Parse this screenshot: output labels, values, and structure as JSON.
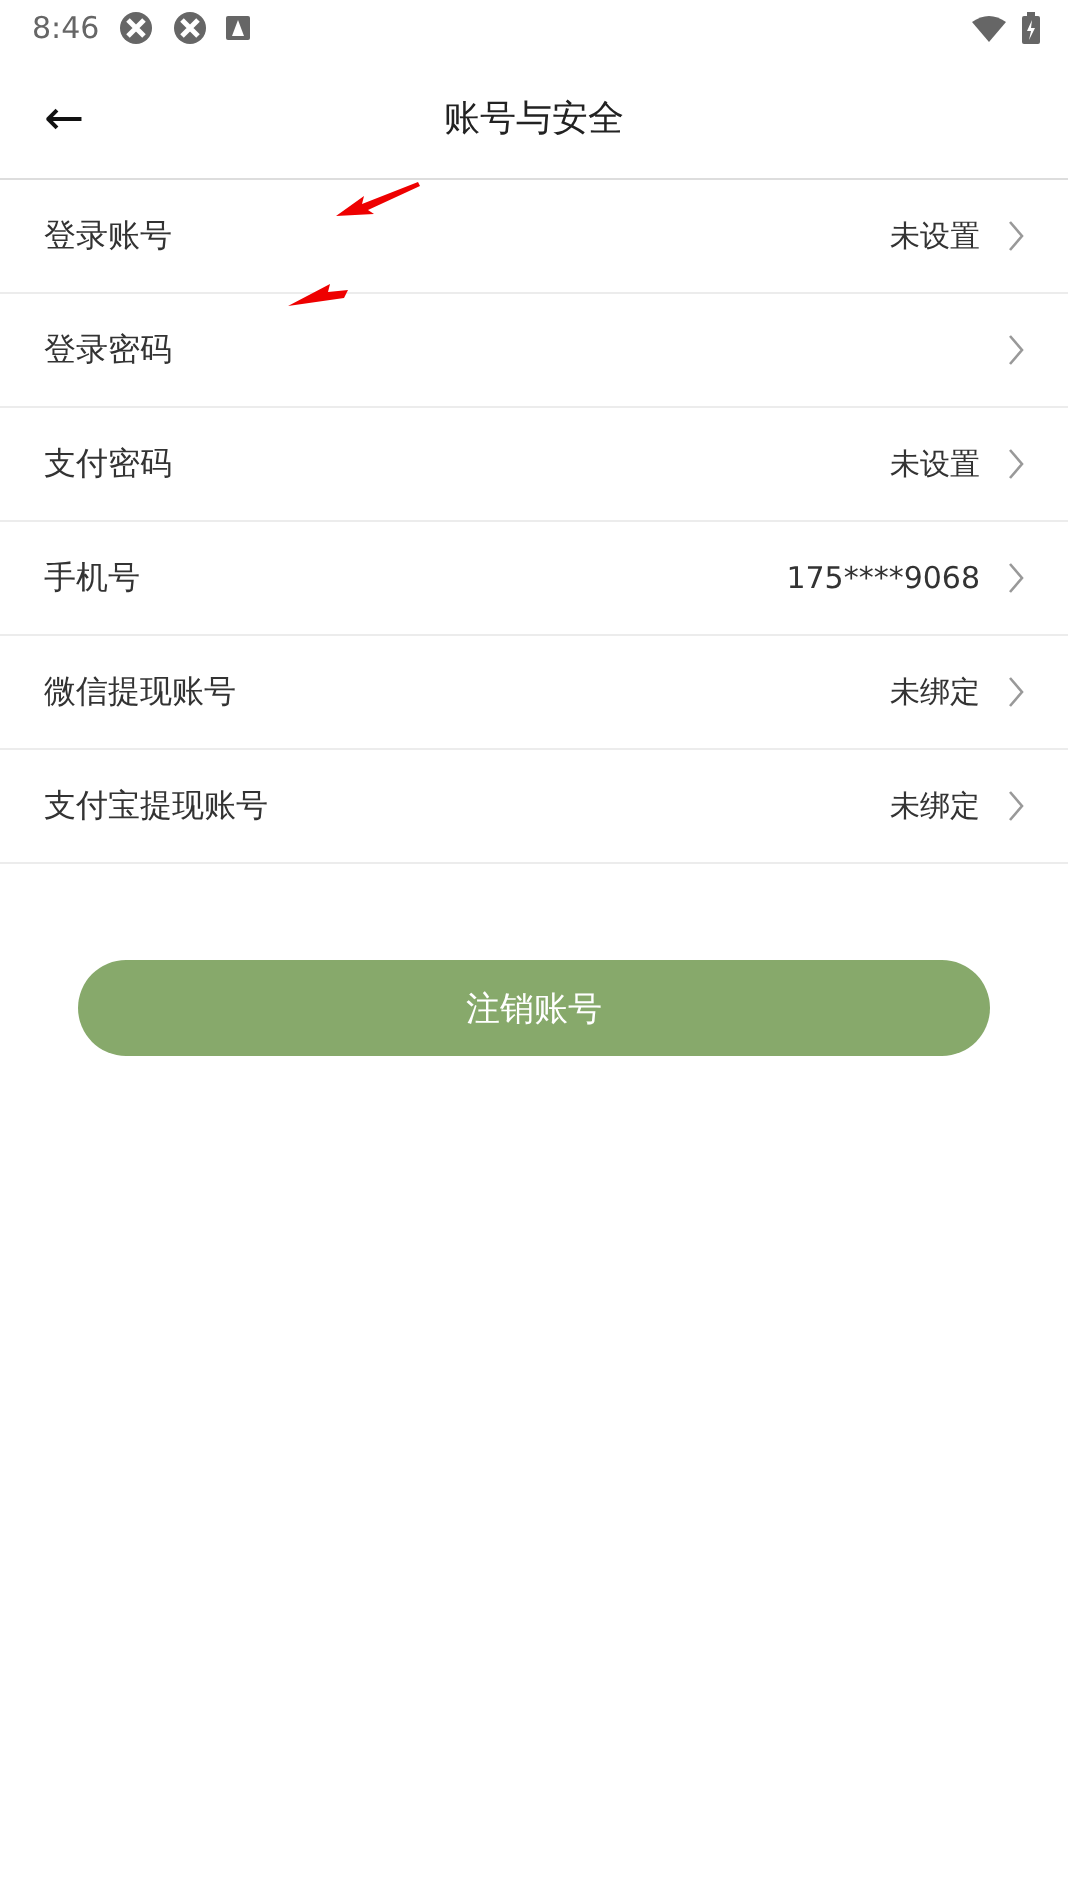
{
  "status_bar": {
    "time": "8:46"
  },
  "header": {
    "back": "←",
    "title": "账号与安全"
  },
  "rows": [
    {
      "label": "登录账号",
      "value": "未设置"
    },
    {
      "label": "登录密码"
    },
    {
      "label": "支付密码",
      "value": "未设置"
    },
    {
      "label": "手机号",
      "value": "175****9068"
    },
    {
      "label": "微信提现账号",
      "value": "未绑定"
    },
    {
      "label": "支付宝提现账号",
      "value": "未绑定"
    }
  ],
  "button": {
    "label": "注销账号"
  }
}
